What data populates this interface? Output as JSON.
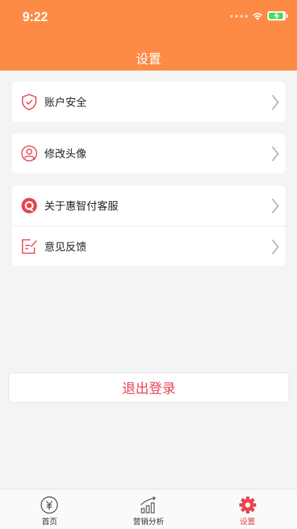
{
  "status_bar": {
    "time": "9:22"
  },
  "header": {
    "title": "设置"
  },
  "groups": {
    "security": {
      "label": "账户安全"
    },
    "avatar": {
      "label": "修改头像"
    },
    "about": {
      "label": "关于惠智付客服"
    },
    "feedback": {
      "label": "意见反馈"
    }
  },
  "logout": {
    "label": "退出登录"
  },
  "tabbar": {
    "tabs": [
      {
        "label": "首页",
        "icon": "yuan-coin-icon",
        "active": false
      },
      {
        "label": "营销分析",
        "icon": "bar-chart-trend-icon",
        "active": false
      },
      {
        "label": "设置",
        "icon": "gear-icon",
        "active": true
      }
    ]
  },
  "colors": {
    "header": "#fd8b45",
    "accent": "#e8444f",
    "background": "#f4f4f4"
  }
}
